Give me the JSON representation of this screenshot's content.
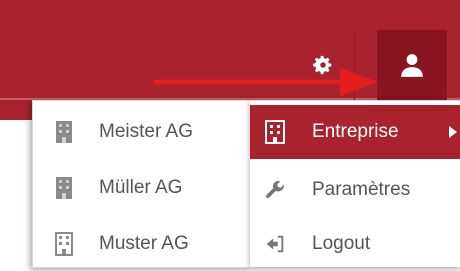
{
  "colors": {
    "brand": "#a8232e",
    "brand_dark": "#8a1420",
    "text": "#555555",
    "arrow": "#e41e1e"
  },
  "header": {
    "settings_icon": "gear-icon",
    "user_icon": "user-icon"
  },
  "companies_submenu": {
    "items": [
      {
        "label": "Meister AG",
        "icon": "building-icon"
      },
      {
        "label": "Müller AG",
        "icon": "building-icon"
      },
      {
        "label": "Muster AG",
        "icon": "building-icon"
      }
    ]
  },
  "user_menu": {
    "items": [
      {
        "label": "Entreprise",
        "icon": "building-icon",
        "active": true,
        "has_submenu": true
      },
      {
        "label": "Paramètres",
        "icon": "wrench-icon"
      },
      {
        "label": "Logout",
        "icon": "logout-icon"
      }
    ]
  }
}
